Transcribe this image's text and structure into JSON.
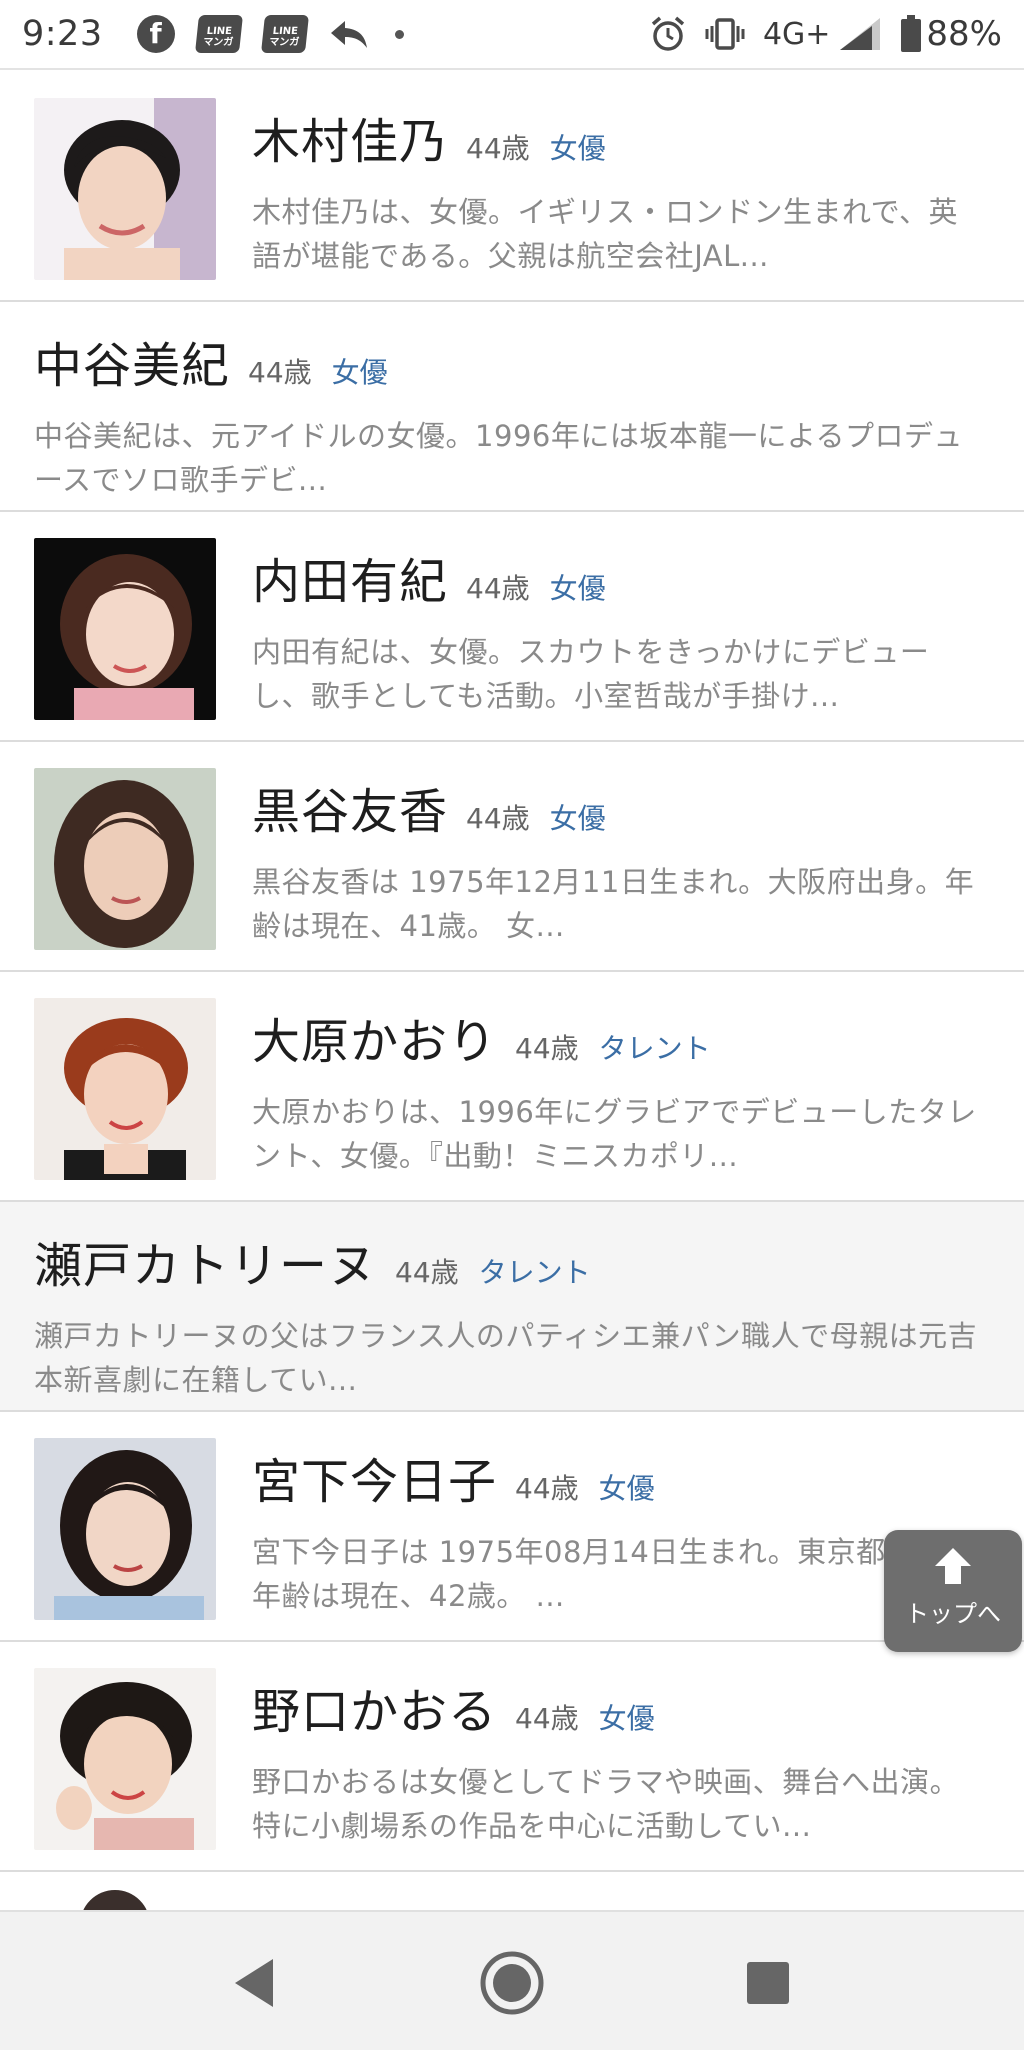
{
  "status_bar": {
    "time": "9:23",
    "notification_icons": [
      "facebook-icon",
      "line-manga-icon",
      "line-manga-icon",
      "reply-icon",
      "dot-icon"
    ],
    "line_manga_text": "LINE\nマンガ",
    "network": "4G+",
    "battery": "88%"
  },
  "list": {
    "items": [
      {
        "name": "木村佳乃",
        "age": "44歳",
        "category": "女優",
        "description": "木村佳乃は、女優。イギリス・ロンドン生まれで、英語が堪能である。父親は航空会社JAL...",
        "has_photo": true
      },
      {
        "name": "中谷美紀",
        "age": "44歳",
        "category": "女優",
        "description": "中谷美紀は、元アイドルの女優。1996年には坂本龍一によるプロデュースでソロ歌手デビ...",
        "has_photo": false
      },
      {
        "name": "内田有紀",
        "age": "44歳",
        "category": "女優",
        "description": "内田有紀は、女優。スカウトをきっかけにデビューし、歌手としても活動。小室哲哉が手掛け...",
        "has_photo": true
      },
      {
        "name": "黒谷友香",
        "age": "44歳",
        "category": "女優",
        "description": "黒谷友香は 1975年12月11日生まれ。大阪府出身。年齢は現在、41歳。 女...",
        "has_photo": true
      },
      {
        "name": "大原かおり",
        "age": "44歳",
        "category": "タレント",
        "description": "大原かおりは、1996年にグラビアでデビューしたタレント、女優。『出動！ミニスカポリ...",
        "has_photo": true
      },
      {
        "name": "瀬戸カトリーヌ",
        "age": "44歳",
        "category": "タレント",
        "description": "瀬戸カトリーヌの父はフランス人のパティシエ兼パン職人で母親は元吉本新喜劇に在籍してい...",
        "has_photo": false
      },
      {
        "name": "宮下今日子",
        "age": "44歳",
        "category": "女優",
        "description": "宮下今日子は 1975年08月14日生まれ。東京都出身。 年齢は現在、42歳。 ...",
        "has_photo": true
      },
      {
        "name": "野口かおる",
        "age": "44歳",
        "category": "女優",
        "description": "野口かおるは女優としてドラマや映画、舞台へ出演。特に小劇場系の作品を中心に活動してい...",
        "has_photo": true
      }
    ]
  },
  "to_top_button": {
    "label": "トップへ",
    "icon": "arrow-up-icon"
  },
  "nav_bar": {
    "icons": [
      "back-triangle-icon",
      "home-circle-icon",
      "recents-square-icon"
    ]
  },
  "colors": {
    "category_link": "#3b6ea5",
    "description_text": "#8a8a8a",
    "to_top_bg": "#6e6e6e"
  }
}
